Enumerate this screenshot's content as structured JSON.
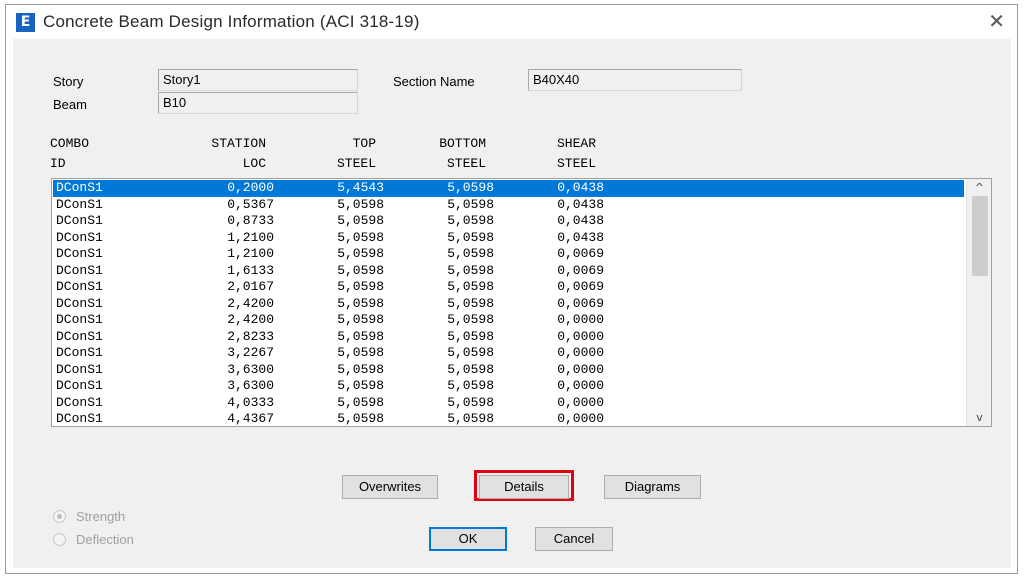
{
  "window": {
    "icon_letter": "E",
    "title": "Concrete Beam Design Information (ACI 318-19)",
    "close_glyph": "✕"
  },
  "fields": {
    "story_label": "Story",
    "story_value": "Story1",
    "beam_label": "Beam",
    "beam_value": "B10",
    "section_label": "Section Name",
    "section_value": "B40X40"
  },
  "table": {
    "headers": [
      {
        "line1": "COMBO",
        "line2": "ID"
      },
      {
        "line1": "STATION",
        "line2": "LOC"
      },
      {
        "line1": "TOP",
        "line2": "STEEL"
      },
      {
        "line1": "BOTTOM",
        "line2": "STEEL"
      },
      {
        "line1": "SHEAR",
        "line2": "STEEL"
      }
    ],
    "rows": [
      [
        "DConS1",
        "0,2000",
        "5,4543",
        "5,0598",
        "0,0438"
      ],
      [
        "DConS1",
        "0,5367",
        "5,0598",
        "5,0598",
        "0,0438"
      ],
      [
        "DConS1",
        "0,8733",
        "5,0598",
        "5,0598",
        "0,0438"
      ],
      [
        "DConS1",
        "1,2100",
        "5,0598",
        "5,0598",
        "0,0438"
      ],
      [
        "DConS1",
        "1,2100",
        "5,0598",
        "5,0598",
        "0,0069"
      ],
      [
        "DConS1",
        "1,6133",
        "5,0598",
        "5,0598",
        "0,0069"
      ],
      [
        "DConS1",
        "2,0167",
        "5,0598",
        "5,0598",
        "0,0069"
      ],
      [
        "DConS1",
        "2,4200",
        "5,0598",
        "5,0598",
        "0,0069"
      ],
      [
        "DConS1",
        "2,4200",
        "5,0598",
        "5,0598",
        "0,0000"
      ],
      [
        "DConS1",
        "2,8233",
        "5,0598",
        "5,0598",
        "0,0000"
      ],
      [
        "DConS1",
        "3,2267",
        "5,0598",
        "5,0598",
        "0,0000"
      ],
      [
        "DConS1",
        "3,6300",
        "5,0598",
        "5,0598",
        "0,0000"
      ],
      [
        "DConS1",
        "3,6300",
        "5,0598",
        "5,0598",
        "0,0000"
      ],
      [
        "DConS1",
        "4,0333",
        "5,0598",
        "5,0598",
        "0,0000"
      ],
      [
        "DConS1",
        "4,4367",
        "5,0598",
        "5,0598",
        "0,0000"
      ]
    ],
    "selected_row": 0,
    "scroll_up_glyph": "^",
    "scroll_down_glyph": "v"
  },
  "buttons": {
    "overwrites": "Overwrites",
    "details": "Details",
    "diagrams": "Diagrams",
    "ok": "OK",
    "cancel": "Cancel"
  },
  "options": {
    "strength": "Strength",
    "deflection": "Deflection",
    "selected": "strength"
  },
  "colors": {
    "selection": "#0078d7",
    "highlight_box": "#e3000f",
    "app_icon": "#1565c0"
  }
}
